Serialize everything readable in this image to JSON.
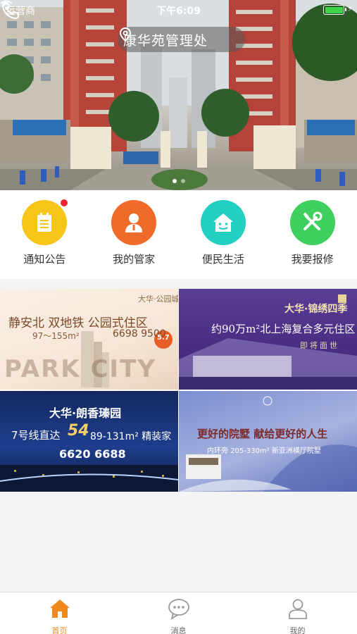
{
  "status_bar": {
    "carrier": "运营商",
    "time": "下午6:09"
  },
  "header": {
    "location": "康华苑管理处"
  },
  "quick_menu": [
    {
      "label": "通知公告",
      "icon": "notice-icon",
      "color": "#f7c51a"
    },
    {
      "label": "我的管家",
      "icon": "butler-icon",
      "color": "#f06a2a"
    },
    {
      "label": "便民生活",
      "icon": "home-face-icon",
      "color": "#22cfc1"
    },
    {
      "label": "我要报修",
      "icon": "tools-icon",
      "color": "#3ecf5f"
    }
  ],
  "ads": {
    "ad1": {
      "brand": "大华·公园城市",
      "headline": "静安北  双地铁  公园式住区",
      "area": "97～155m²",
      "phone": "6698 9500",
      "badge": "5.7",
      "banner": "PARK CITY"
    },
    "ad2": {
      "brand": "大华·锦绣四季",
      "headline": "约90万m²北上海复合多元住区",
      "tagline": "即将面世"
    },
    "ad3": {
      "brand": "大华·朗香瑧园",
      "prefix": "7号线直达",
      "big": "54",
      "size": "89-131m² 精装家",
      "phone": "6620 6688"
    },
    "ad4": {
      "headline": "更好的院墅  献给更好的人生",
      "sub": "内环旁 205-330m² 新亚洲横厅院墅"
    }
  },
  "tabbar": [
    {
      "label": "首页",
      "icon": "home-icon",
      "active": true
    },
    {
      "label": "消息",
      "icon": "message-icon",
      "active": false
    },
    {
      "label": "我的",
      "icon": "profile-icon",
      "active": false
    }
  ],
  "colors": {
    "accent": "#f08a1c",
    "badge": "#f0232e"
  }
}
